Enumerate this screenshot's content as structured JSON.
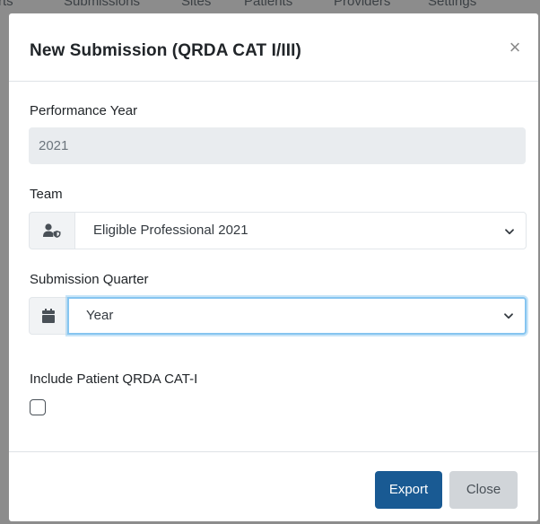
{
  "background_nav": {
    "items": [
      "rts",
      "Submissions",
      "Sites",
      "Patients",
      "Providers",
      "Settings"
    ]
  },
  "modal": {
    "title": "New Submission (QRDA CAT I/III)",
    "close_symbol": "×",
    "close_icon": "close-icon"
  },
  "form": {
    "performance_year": {
      "label": "Performance Year",
      "value": "2021"
    },
    "team": {
      "label": "Team",
      "icon": "user-shield-icon",
      "selected": "Eligible Professional 2021"
    },
    "submission_quarter": {
      "label": "Submission Quarter",
      "icon": "calendar-icon",
      "selected": "Year"
    },
    "include_patient": {
      "label": "Include Patient QRDA CAT-I",
      "checked": false
    }
  },
  "footer": {
    "export_label": "Export",
    "close_label": "Close"
  },
  "colors": {
    "primary": "#195a93",
    "secondary": "#d1d5d9",
    "focus_ring": "#86c5f0",
    "readonly_bg": "#e9ecef"
  }
}
